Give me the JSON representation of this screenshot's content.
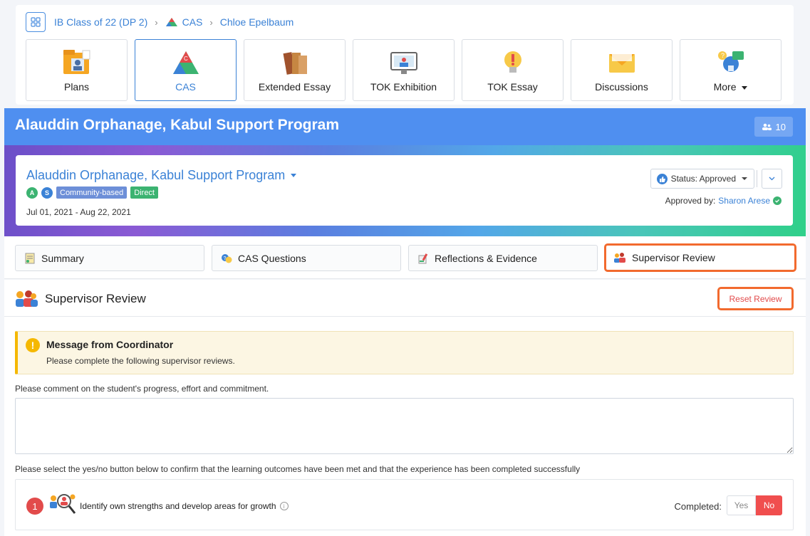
{
  "breadcrumb": {
    "items": [
      "IB Class of 22 (DP 2)",
      "CAS",
      "Chloe Epelbaum"
    ]
  },
  "modules": [
    {
      "label": "Plans",
      "icon": "plans-icon"
    },
    {
      "label": "CAS",
      "icon": "cas-triangle-icon",
      "active": true
    },
    {
      "label": "Extended Essay",
      "icon": "books-icon"
    },
    {
      "label": "TOK Exhibition",
      "icon": "exhibition-icon"
    },
    {
      "label": "TOK Essay",
      "icon": "lightbulb-icon"
    },
    {
      "label": "Discussions",
      "icon": "envelope-icon"
    },
    {
      "label": "More",
      "icon": "more-modules-icon"
    }
  ],
  "banner": {
    "title": "Alauddin Orphanage, Kabul Support Program",
    "members_count": "10"
  },
  "project": {
    "title": "Alauddin Orphanage, Kabul Support Program",
    "badges": [
      "A",
      "S"
    ],
    "tags": [
      "Community-based",
      "Direct"
    ],
    "dates": "Jul 01, 2021 - Aug 22, 2021",
    "status": "Status: Approved",
    "approved_by_label": "Approved by:",
    "approved_by_name": "Sharon Arese"
  },
  "tabs": [
    {
      "label": "Summary",
      "icon": "summary-icon"
    },
    {
      "label": "CAS Questions",
      "icon": "questions-icon"
    },
    {
      "label": "Reflections & Evidence",
      "icon": "reflections-icon"
    },
    {
      "label": "Supervisor Review",
      "icon": "supervisor-icon",
      "highlight": true
    }
  ],
  "section": {
    "title": "Supervisor Review",
    "reset_label": "Reset Review"
  },
  "message": {
    "title": "Message from Coordinator",
    "body": "Please complete the following supervisor reviews."
  },
  "comment": {
    "label": "Please comment on the student's progress, effort and commitment.",
    "value": ""
  },
  "confirm_label": "Please select the yes/no button below to confirm that the learning outcomes have been met and that the experience has been completed successfully",
  "outcomes": [
    {
      "number": "1",
      "text": "Identify own strengths and develop areas for growth",
      "completed_label": "Completed:",
      "yes_label": "Yes",
      "no_label": "No",
      "selected": "No"
    }
  ],
  "colors": {
    "accent": "#3b82d6",
    "banner": "#4f8ff0",
    "highlight_border": "#f26a2e",
    "danger": "#f04e4e"
  }
}
